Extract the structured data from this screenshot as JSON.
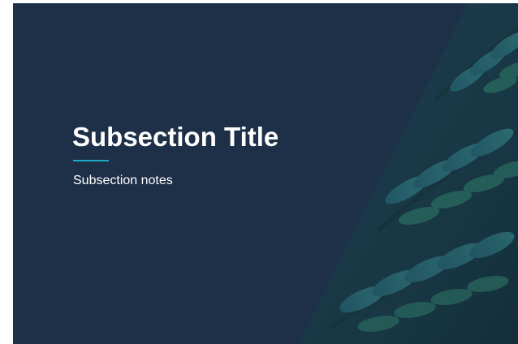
{
  "slide": {
    "title": "Subsection Title",
    "notes": "Subsection notes"
  },
  "colors": {
    "background": "#1e3048",
    "accent": "#1fa8c7",
    "text": "#ffffff",
    "leaf": "#2f7f8a"
  },
  "decoration": {
    "image": "fern-leaves-photo"
  }
}
